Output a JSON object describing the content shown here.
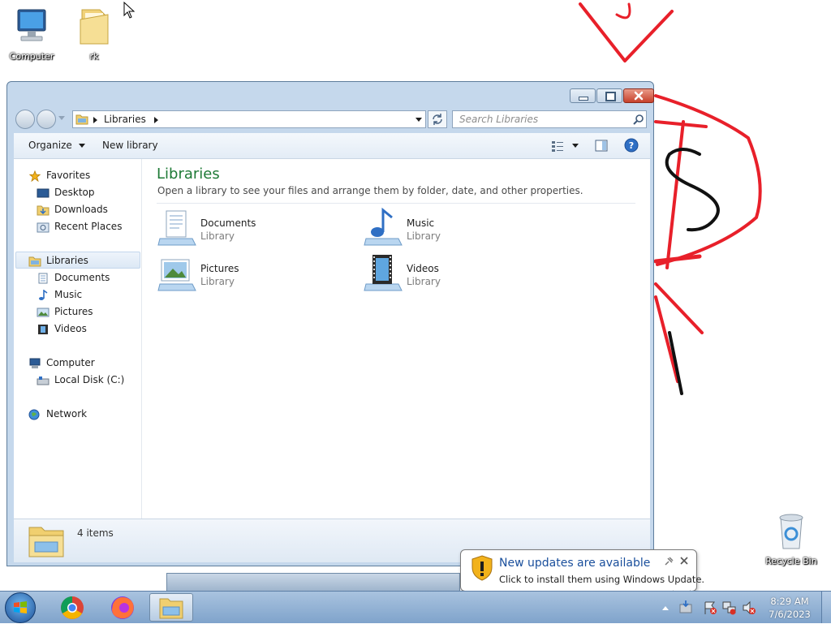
{
  "desktop": {
    "icons": [
      {
        "label": "Computer"
      },
      {
        "label": "rk"
      },
      {
        "label": "Recycle Bin"
      }
    ]
  },
  "window": {
    "address": {
      "segment": "Libraries"
    },
    "search": {
      "placeholder": "Search Libraries"
    },
    "toolbar": {
      "organize": "Organize",
      "new_library": "New library"
    },
    "nav": {
      "favorites": {
        "label": "Favorites",
        "items": [
          "Desktop",
          "Downloads",
          "Recent Places"
        ]
      },
      "libraries": {
        "label": "Libraries",
        "items": [
          "Documents",
          "Music",
          "Pictures",
          "Videos"
        ]
      },
      "computer": {
        "label": "Computer",
        "items": [
          "Local Disk (C:)"
        ]
      },
      "network": {
        "label": "Network"
      }
    },
    "content": {
      "title": "Libraries",
      "subtitle": "Open a library to see your files and arrange them by folder, date, and other properties.",
      "tiles": [
        {
          "name": "Documents",
          "type": "Library"
        },
        {
          "name": "Music",
          "type": "Library"
        },
        {
          "name": "Pictures",
          "type": "Library"
        },
        {
          "name": "Videos",
          "type": "Library"
        }
      ]
    },
    "details": {
      "count": "4 items"
    }
  },
  "notification": {
    "title": "New updates are available",
    "message": "Click to install them using Windows Update."
  },
  "taskbar": {
    "clock": {
      "time": "8:29 AM",
      "date": "7/6/2023"
    }
  },
  "colors": {
    "title_green": "#1e7a36",
    "notif_blue": "#1a4f9c",
    "drawing_red": "#e8202a"
  }
}
